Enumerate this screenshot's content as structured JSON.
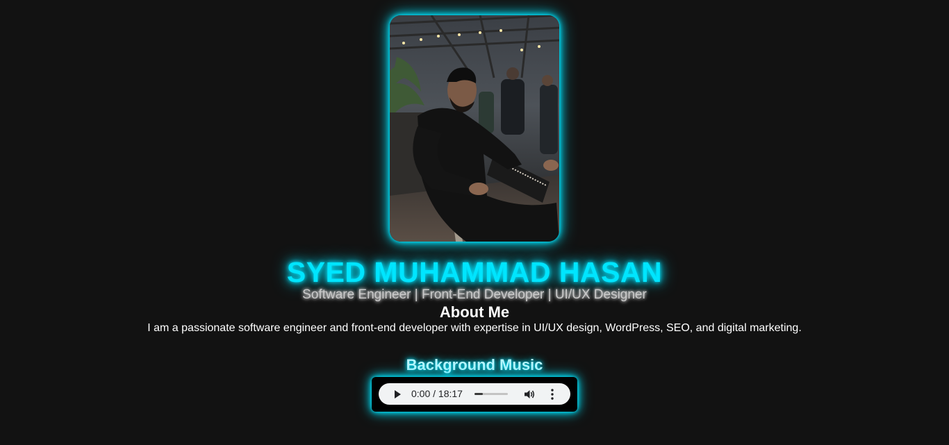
{
  "profile": {
    "photo_alt": "Profile photo",
    "name": "SYED MUHAMMAD HASAN",
    "subtitle": "Software Engineer | Front-End Developer | UI/UX Designer"
  },
  "about": {
    "title": "About Me",
    "text": "I am a passionate software engineer and front-end developer with expertise in UI/UX design, WordPress, SEO, and digital marketing."
  },
  "music": {
    "title": "Background Music",
    "time_display": "0:00 / 18:17",
    "progress_fraction": 0.25,
    "icons": {
      "play": "play-icon",
      "volume": "volume-icon",
      "more": "more-vertical-icon"
    }
  },
  "colors": {
    "background": "#121212",
    "accent": "#00e5ff",
    "text": "#ffffff"
  }
}
